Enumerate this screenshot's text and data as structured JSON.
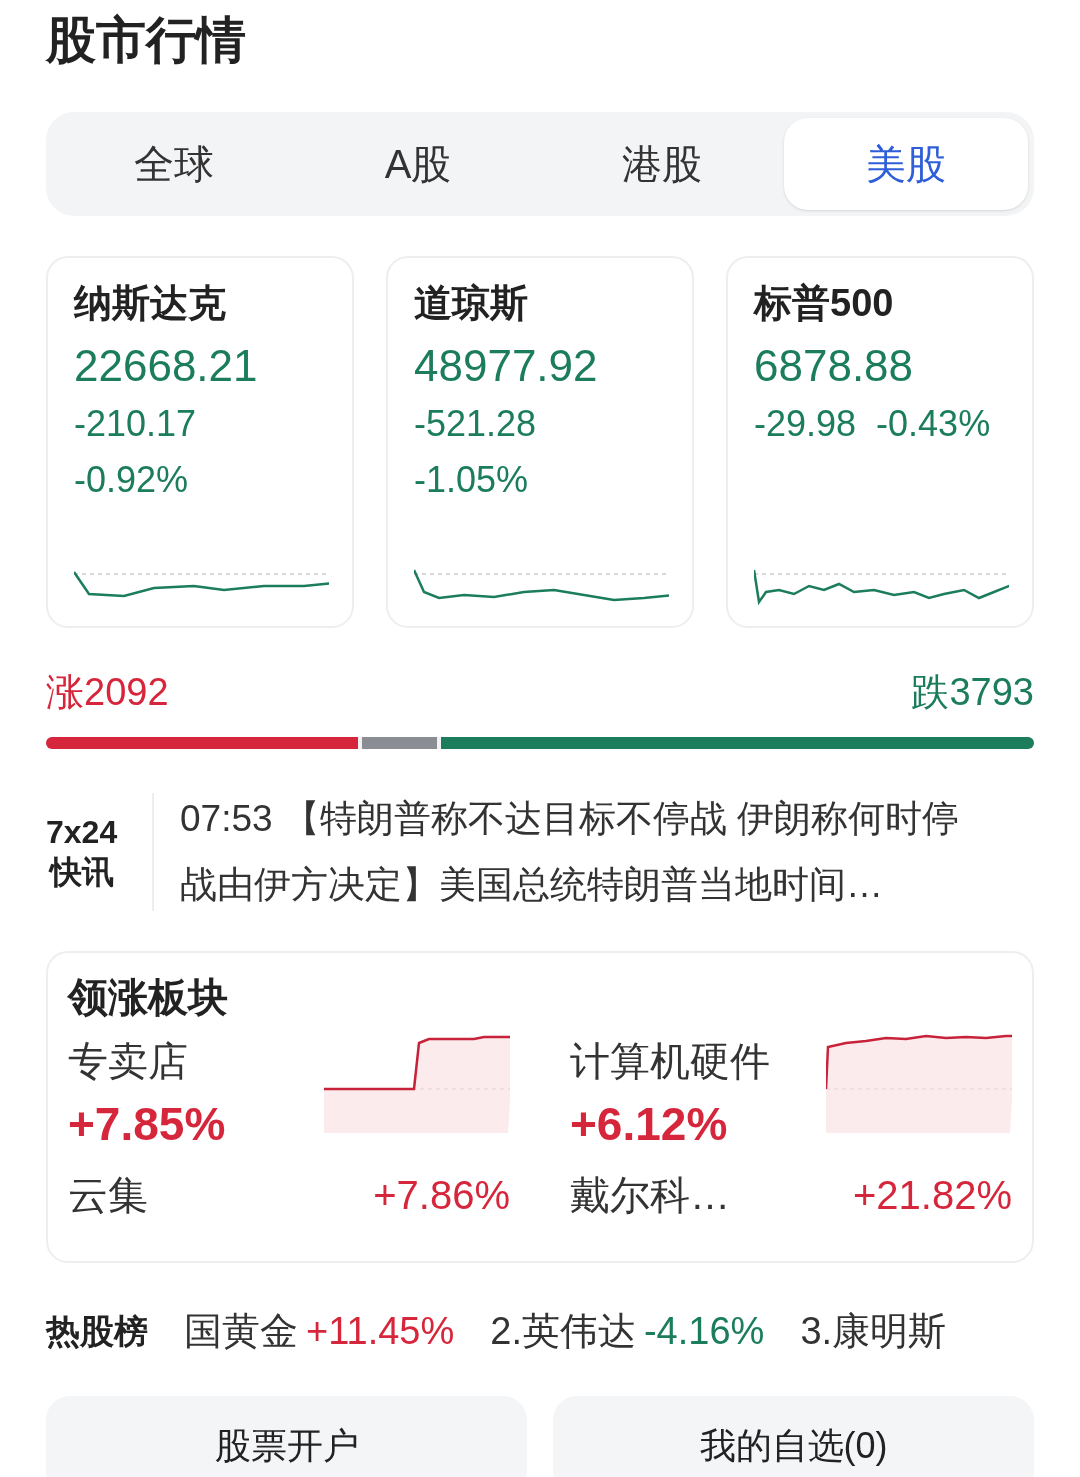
{
  "title": "股市行情",
  "tabs": [
    {
      "label": "全球",
      "selected": false
    },
    {
      "label": "A股",
      "selected": false
    },
    {
      "label": "港股",
      "selected": false
    },
    {
      "label": "美股",
      "selected": true
    }
  ],
  "indices": [
    {
      "name": "纳斯达克",
      "price": "22668.21",
      "change": "-210.17",
      "percent": "-0.92%",
      "kind": "stacked"
    },
    {
      "name": "道琼斯",
      "price": "48977.92",
      "change": "-521.28",
      "percent": "-1.05%",
      "kind": "stacked"
    },
    {
      "name": "标普500",
      "price": "6878.88",
      "change": "-29.98",
      "percent": "-0.43%",
      "kind": "inline"
    }
  ],
  "breadth": {
    "up": {
      "label": "涨2092",
      "level": 0.32
    },
    "down": {
      "label": "跌3793",
      "level": 0.6
    }
  },
  "news": {
    "label_top": "7x24",
    "label_bottom": "快讯",
    "time": "07:53",
    "text": "【特朗普称不达目标不停战 伊朗称何时停战由伊方决定】美国总统特朗普当地时间…"
  },
  "sectors": {
    "title": "领涨板块",
    "items": [
      {
        "name": "专卖店",
        "change": "+7.85%",
        "stock": "云集",
        "stock_change": "+7.86%"
      },
      {
        "name": "计算机硬件",
        "change": "+6.12%",
        "stock": "戴尔科…",
        "stock_change": "+21.82%"
      }
    ]
  },
  "hot": {
    "title": "热股榜",
    "items": [
      {
        "name": "国黄金",
        "change": "+11.45%",
        "kind": "up"
      },
      {
        "name": "2.英伟达",
        "change": "-4.16%",
        "kind": "down"
      },
      {
        "name": "3.康明斯",
        "kind": "none"
      }
    ]
  },
  "buttons": [
    "股票开户",
    "我的自选(0)"
  ]
}
